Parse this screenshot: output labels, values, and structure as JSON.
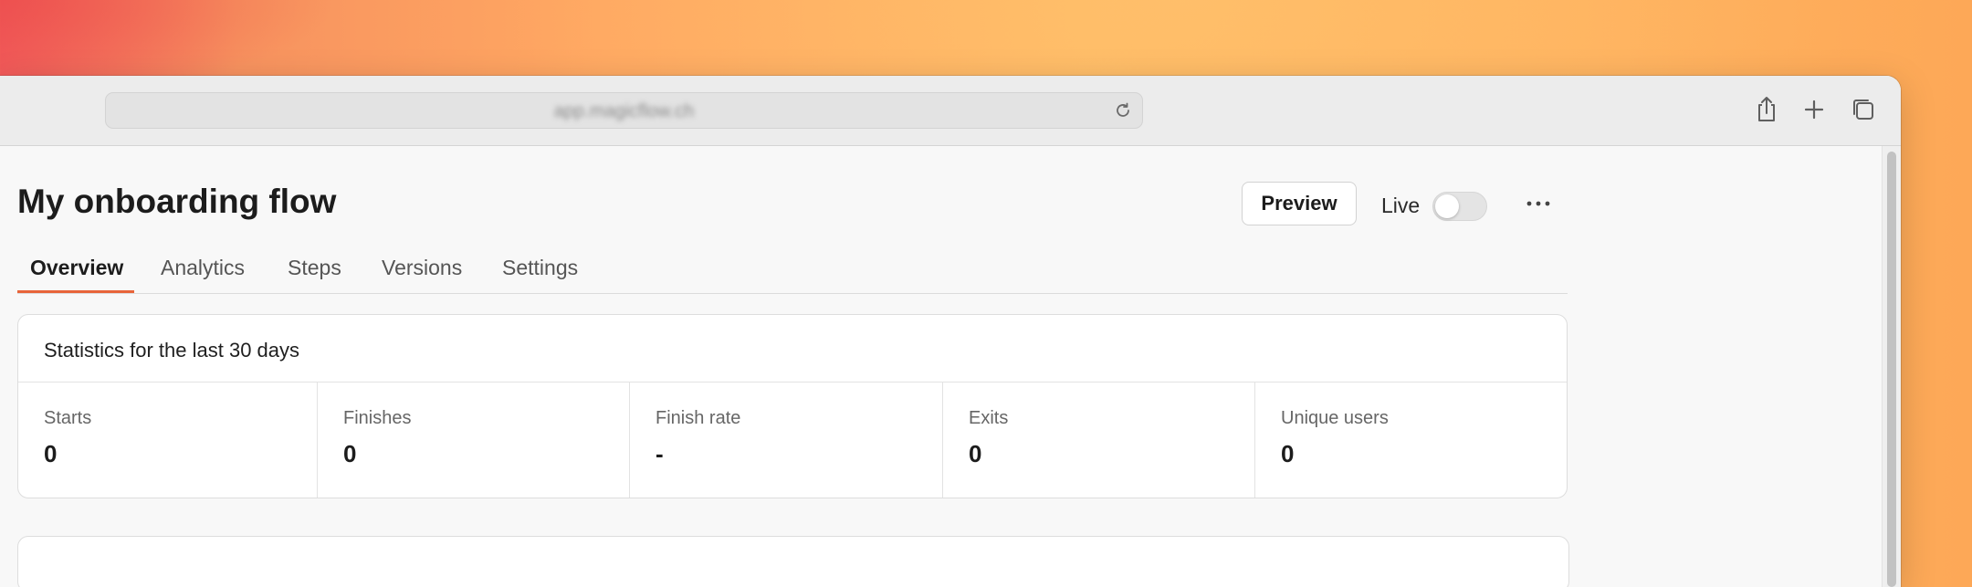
{
  "browser": {
    "url": "app.magicflow.ch",
    "icons": [
      "reload-icon",
      "share-icon",
      "new-tab-icon",
      "tabs-overview-icon"
    ]
  },
  "page": {
    "title": "My onboarding flow",
    "preview_label": "Preview",
    "live_label": "Live",
    "live_on": false,
    "more_icon": "more-horizontal-icon",
    "accent_color": "#e8643a"
  },
  "tabs": [
    {
      "label": "Overview",
      "active": true
    },
    {
      "label": "Analytics",
      "active": false
    },
    {
      "label": "Steps",
      "active": false
    },
    {
      "label": "Versions",
      "active": false
    },
    {
      "label": "Settings",
      "active": false
    }
  ],
  "stats": {
    "heading": "Statistics for the last 30 days",
    "items": [
      {
        "label": "Starts",
        "value": "0"
      },
      {
        "label": "Finishes",
        "value": "0"
      },
      {
        "label": "Finish rate",
        "value": "-"
      },
      {
        "label": "Exits",
        "value": "0"
      },
      {
        "label": "Unique users",
        "value": "0"
      }
    ]
  }
}
